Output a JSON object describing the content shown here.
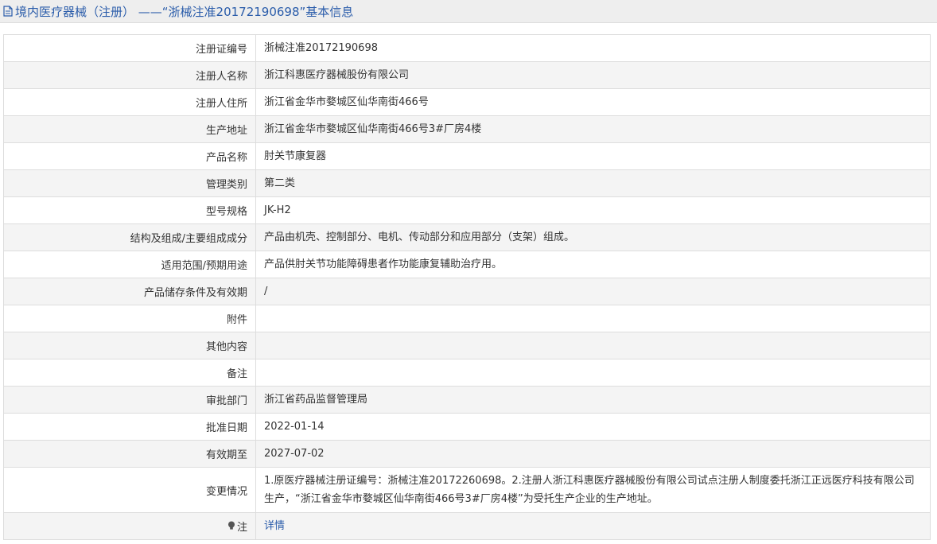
{
  "header": {
    "title": "境内医疗器械（注册） ——“浙械注准20172190698”基本信息"
  },
  "rows": [
    {
      "label": "注册证编号",
      "value": "浙械注准20172190698"
    },
    {
      "label": "注册人名称",
      "value": "浙江科惠医疗器械股份有限公司"
    },
    {
      "label": "注册人住所",
      "value": "浙江省金华市婺城区仙华南街466号"
    },
    {
      "label": "生产地址",
      "value": "浙江省金华市婺城区仙华南街466号3#厂房4楼"
    },
    {
      "label": "产品名称",
      "value": "肘关节康复器"
    },
    {
      "label": "管理类别",
      "value": "第二类"
    },
    {
      "label": "型号规格",
      "value": "JK-H2"
    },
    {
      "label": "结构及组成/主要组成成分",
      "value": "产品由机壳、控制部分、电机、传动部分和应用部分（支架）组成。"
    },
    {
      "label": "适用范围/预期用途",
      "value": "产品供肘关节功能障碍患者作功能康复辅助治疗用。"
    },
    {
      "label": "产品储存条件及有效期",
      "value": "/"
    },
    {
      "label": "附件",
      "value": ""
    },
    {
      "label": "其他内容",
      "value": ""
    },
    {
      "label": "备注",
      "value": ""
    },
    {
      "label": "审批部门",
      "value": "浙江省药品监督管理局"
    },
    {
      "label": "批准日期",
      "value": "2022-01-14"
    },
    {
      "label": "有效期至",
      "value": "2027-07-02"
    },
    {
      "label": "变更情况",
      "value": "1.原医疗器械注册证编号：浙械注准20172260698。2.注册人浙江科惠医疗器械股份有限公司试点注册人制度委托浙江正远医疗科技有限公司生产，“浙江省金华市婺城区仙华南街466号3#厂房4楼”为受托生产企业的生产地址。"
    }
  ],
  "note": {
    "label": "注",
    "link": "详情"
  },
  "colors": {
    "link": "#2a5caa",
    "border": "#dddddd",
    "stripe": "#f4f4f4",
    "header_bg": "#eeeeee"
  },
  "icons": {
    "title": "document-icon",
    "note": "lightbulb-icon"
  }
}
